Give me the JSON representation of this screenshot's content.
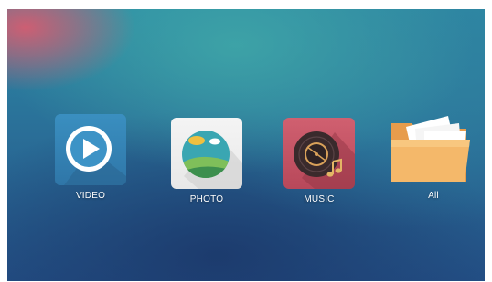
{
  "apps": [
    {
      "id": "video",
      "label": "VIDEO",
      "icon": "play-icon",
      "color": "#2f76a8"
    },
    {
      "id": "photo",
      "label": "PHOTO",
      "icon": "landscape-photo-icon",
      "color": "#efefef"
    },
    {
      "id": "music",
      "label": "MUSIC",
      "icon": "vinyl-record-icon",
      "color": "#c0505f"
    },
    {
      "id": "all",
      "label": "All",
      "icon": "folder-icon",
      "color": "#f0b060"
    }
  ]
}
